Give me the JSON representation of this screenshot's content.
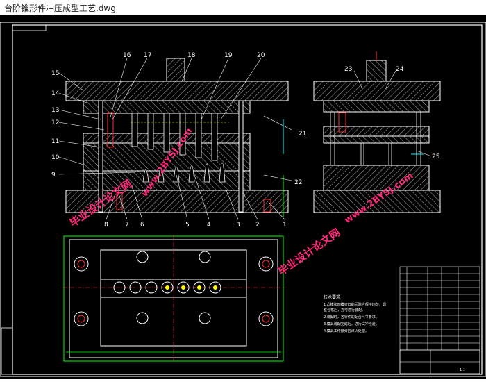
{
  "window": {
    "title": "台阶锥形件冲压成型工艺.dwg"
  },
  "drawing": {
    "front_view_callouts_top": [
      "16",
      "17",
      "18",
      "19",
      "20"
    ],
    "front_view_callouts_left": [
      "15",
      "14",
      "13",
      "12",
      "11",
      "10",
      "9"
    ],
    "front_view_callouts_bottom": [
      "8",
      "7",
      "6",
      "5",
      "4",
      "3",
      "2",
      "1"
    ],
    "front_view_callouts_right": [
      "21",
      "22"
    ],
    "side_view_callouts": [
      "23",
      "24",
      "25"
    ],
    "watermarks": [
      "www.2BYSJ.com",
      "毕业设计论文网"
    ],
    "tech_requirements": {
      "heading": "技术要求",
      "lines": [
        "1.凸模和凹模刃口的间隙应保持均匀，调",
        "整合格后，方可进行装配。",
        "2.装配时，各零件的配合尺寸要求。",
        "3.模具装配完成后，进行试冲检验。",
        "4.模具工作部分应淬火处理。"
      ]
    },
    "title_block": {
      "scale": "1:1"
    }
  },
  "colors": {
    "line": "#ffffff",
    "hatch": "#bfbfbf",
    "yellow": "#ffff00",
    "green": "#00ff00",
    "cyan": "#00ffff",
    "red": "#ff3030",
    "watermark": "#ff2a7a"
  }
}
